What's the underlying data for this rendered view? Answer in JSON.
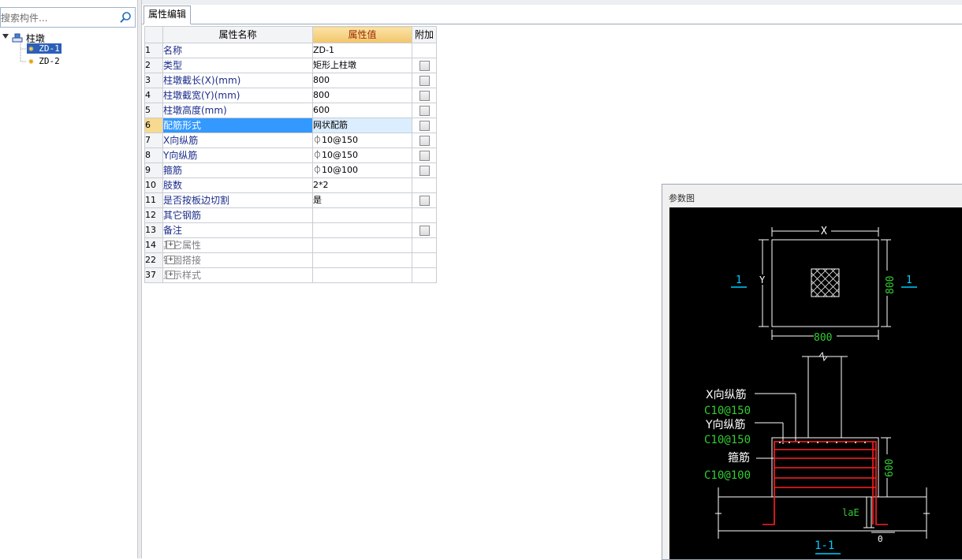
{
  "search": {
    "placeholder": "搜索构件..."
  },
  "tree": {
    "root_label": "柱墩",
    "items": [
      {
        "label": "ZD-1",
        "selected": true
      },
      {
        "label": "ZD-2",
        "selected": false
      }
    ]
  },
  "tab": {
    "label": "属性编辑"
  },
  "grid": {
    "headers": {
      "name": "属性名称",
      "value": "属性值",
      "add": "附加"
    },
    "rows": [
      {
        "num": "1",
        "name": "名称",
        "value": "ZD-1",
        "checkbox": false
      },
      {
        "num": "2",
        "name": "类型",
        "value": "矩形上柱墩",
        "checkbox": true
      },
      {
        "num": "3",
        "name": "柱墩截长(X)(mm)",
        "value": "800",
        "checkbox": true
      },
      {
        "num": "4",
        "name": "柱墩截宽(Y)(mm)",
        "value": "800",
        "checkbox": true
      },
      {
        "num": "5",
        "name": "柱墩高度(mm)",
        "value": "600",
        "checkbox": true
      },
      {
        "num": "6",
        "name": "配筋形式",
        "value": "网状配筋",
        "checkbox": true
      },
      {
        "num": "7",
        "name": "X向纵筋",
        "value": "⏀10@150",
        "checkbox": true
      },
      {
        "num": "8",
        "name": "Y向纵筋",
        "value": "⏀10@150",
        "checkbox": true
      },
      {
        "num": "9",
        "name": "箍筋",
        "value": "⏀10@100",
        "checkbox": true
      },
      {
        "num": "10",
        "name": "肢数",
        "value": "2*2",
        "checkbox": false
      },
      {
        "num": "11",
        "name": "是否按板边切割",
        "value": "是",
        "checkbox": true
      },
      {
        "num": "12",
        "name": "其它钢筋",
        "value": "",
        "checkbox": false
      },
      {
        "num": "13",
        "name": "备注",
        "value": "",
        "checkbox": true
      },
      {
        "num": "14",
        "name": "其它属性",
        "value": "",
        "checkbox": false
      },
      {
        "num": "22",
        "name": "锚固搭接",
        "value": "",
        "checkbox": false
      },
      {
        "num": "37",
        "name": "显示样式",
        "value": "",
        "checkbox": false
      }
    ]
  },
  "diagram": {
    "title": "参数图",
    "plan": {
      "x_label": "X",
      "y_label": "Y",
      "dim_bottom": "800",
      "dim_right": "800",
      "section_mark": "1"
    },
    "section": {
      "x_rebar_label": "X向纵筋",
      "x_rebar_value": "C10@150",
      "y_rebar_label": "Y向纵筋",
      "y_rebar_value": "C10@150",
      "stirrup_label": "箍筋",
      "stirrup_value": "C10@100",
      "height_dim": "600",
      "anchor_label": "laE",
      "cover_label": "0",
      "section_name": "1-1"
    },
    "colors": {
      "bg": "#000000",
      "line": "#ffffff",
      "rebar": "#ff2020",
      "dim": "#33cc33",
      "mark": "#00ccff"
    }
  }
}
